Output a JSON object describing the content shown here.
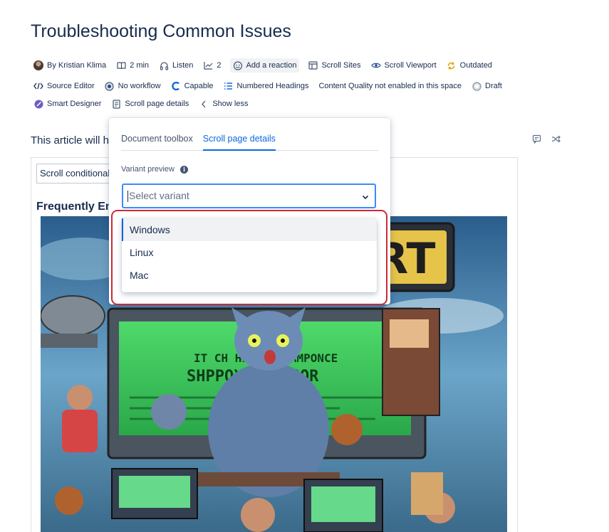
{
  "page": {
    "title": "Troubleshooting Common Issues"
  },
  "meta": {
    "author": "By Kristian Klima",
    "read_time": "2 min",
    "listen": "Listen",
    "analytics_count": "2",
    "add_reaction": "Add a reaction",
    "scroll_sites": "Scroll Sites",
    "scroll_viewport": "Scroll Viewport",
    "outdated": "Outdated",
    "source_editor": "Source Editor",
    "no_workflow": "No workflow",
    "capable": "Capable",
    "numbered_headings": "Numbered Headings",
    "content_quality": "Content Quality not enabled in this space",
    "draft": "Draft",
    "smart_designer": "Smart Designer",
    "scroll_page_details": "Scroll page details",
    "show_less": "Show less"
  },
  "content": {
    "intro": "This article will h",
    "conditional": "Scroll conditional",
    "faq_heading": "Frequently En"
  },
  "panel": {
    "tabs": [
      "Document toolbox",
      "Scroll page details"
    ],
    "active_tab": "Scroll page details",
    "variant_label": "Variant preview",
    "select_placeholder": "Select variant",
    "options": [
      "Windows",
      "Linux",
      "Mac"
    ],
    "highlighted_option": "Windows"
  },
  "colors": {
    "accent": "#0c66e4",
    "focus": "#388bff",
    "annotation": "#cc2936"
  }
}
